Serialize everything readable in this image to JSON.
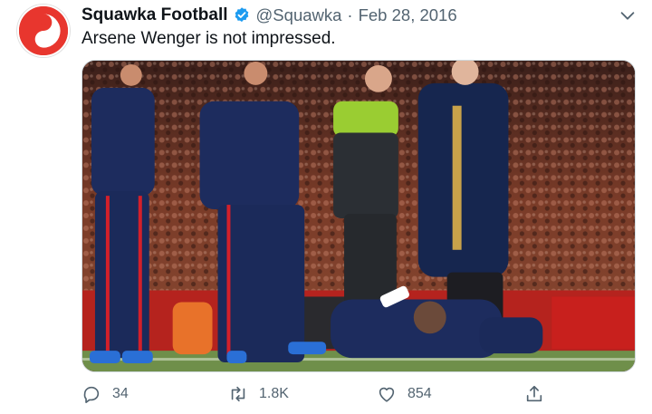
{
  "tweet": {
    "author_name": "Squawka Football",
    "handle": "@Squawka",
    "separator": "·",
    "date": "Feb 28, 2016",
    "text": "Arsene Wenger is not impressed.",
    "verified": true
  },
  "actions": {
    "reply_count": "34",
    "retweet_count": "1.8K",
    "like_count": "854"
  },
  "colors": {
    "brand_red": "#e8362e",
    "verified_blue": "#1d9bf0",
    "muted_text": "#536471"
  },
  "icons": [
    "reply-icon",
    "retweet-icon",
    "like-icon",
    "share-icon",
    "verified-badge-icon",
    "chevron-down-icon"
  ]
}
